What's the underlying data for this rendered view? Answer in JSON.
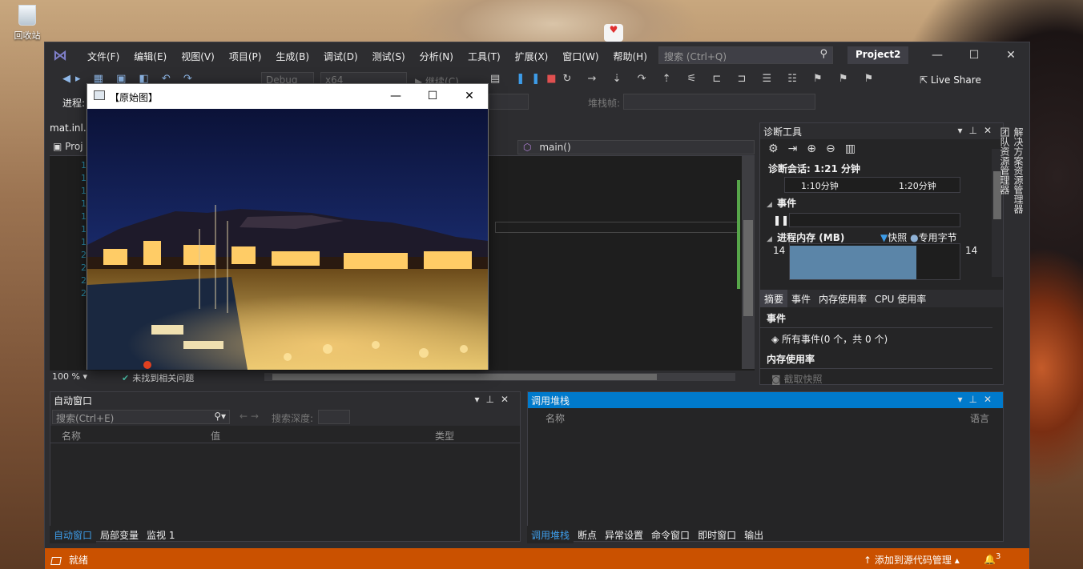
{
  "desktop": {
    "recycle_bin_label": "回收站"
  },
  "vs": {
    "menu": [
      "文件(F)",
      "编辑(E)",
      "视图(V)",
      "项目(P)",
      "生成(B)",
      "调试(D)",
      "测试(S)",
      "分析(N)",
      "工具(T)",
      "扩展(X)",
      "窗口(W)",
      "帮助(H)"
    ],
    "search_placeholder": "搜索 (Ctrl+Q)",
    "project_name": "Project2",
    "toolbar": {
      "config": "Debug",
      "platform": "x64",
      "continue_label": "继续(C)",
      "live_share": "Live Share",
      "process_label": "进程:",
      "stack_frame_label": "堆栈帧:"
    },
    "editor": {
      "doc_tab": "mat.inl...",
      "nav_project": "Proj",
      "nav_function": "main()",
      "zoom": "100 %",
      "issues": "未找到相关问题",
      "line_numbers": [
        "1",
        "1",
        "1",
        "1",
        "1",
        "1",
        "1",
        "2",
        "2",
        "2",
        "2"
      ]
    },
    "image_window": {
      "title": "【原始图】"
    },
    "diagnostics": {
      "title": "诊断工具",
      "session": "诊断会话: 1:21 分钟",
      "t1": "1:10分钟",
      "t2": "1:20分钟",
      "events_section": "事件",
      "memory_section": "进程内存 (MB)",
      "legend_snapshot": "快照",
      "legend_private": "专用字节",
      "mem_left": "14",
      "mem_right": "14",
      "tabs": [
        "摘要",
        "事件",
        "内存使用率",
        "CPU 使用率"
      ],
      "events_header": "事件",
      "all_events": "所有事件(0 个，共 0 个)",
      "mem_usage_header": "内存使用率",
      "take_snapshot": "截取快照"
    },
    "side_tabs": [
      "解决方案资源管理器",
      "团队资源管理器"
    ],
    "autos": {
      "title": "自动窗口",
      "search_placeholder": "搜索(Ctrl+E)",
      "search_depth": "搜索深度:",
      "col_name": "名称",
      "col_value": "值",
      "col_type": "类型",
      "tabs": [
        "自动窗口",
        "局部变量",
        "监视 1"
      ]
    },
    "callstack": {
      "title": "调用堆栈",
      "col_name": "名称",
      "col_lang": "语言",
      "tabs": [
        "调用堆栈",
        "断点",
        "异常设置",
        "命令窗口",
        "即时窗口",
        "输出"
      ]
    },
    "status": {
      "ready": "就绪",
      "add_source": "添加到源代码管理",
      "notifications": "3"
    }
  }
}
